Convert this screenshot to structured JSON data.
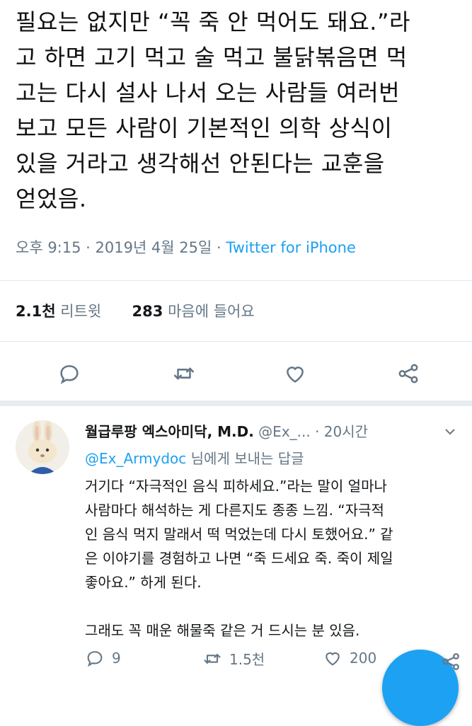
{
  "tweet": {
    "text": "필요는 없지만 “꼭 죽 안 먹어도 돼요.”라\n고 하면 고기 먹고 술 먹고 불닭볶음면 먹\n고는 다시 설사 나서 오는 사람들 여러번\n보고 모든 사람이 기본적인 의학 상식이\n있을 거라고 생각해선 안된다는 교훈을\n얻었음.",
    "timestamp": "오후 9:15 · 2019년 4월 25일 · ",
    "source": "Twitter for iPhone",
    "retweet_count": "2.1천",
    "retweet_label": " 리트윗",
    "like_count": "283",
    "like_label": " 마음에 들어요"
  },
  "reply": {
    "name": "월급루팡 엑스아미닥, M.D.",
    "handle": " @Ex_...",
    "time": " · 20시간",
    "replying_handle": "@Ex_Armydoc",
    "replying_suffix": " 님에게 보내는 답글",
    "text": "거기다 “자극적인 음식 피하세요.”라는 말이 얼마나\n사람마다 해석하는 게 다른지도 종종 느낌. “자극적\n인 음식 먹지 말래서 떡 먹었는데 다시 토했어요.” 같\n은 이야기를 경험하고 나면 “죽 드세요 죽. 죽이 제일\n좋아요.” 하게 된다.\n\n그래도 꼭 매운 해물죽 같은 거 드시는 분 있음.",
    "reply_count": "9",
    "retweet_count": "1.5천",
    "like_count": "200"
  },
  "icons": {
    "reply": "reply-icon",
    "retweet": "retweet-icon",
    "like": "heart-icon",
    "share": "share-icon"
  },
  "colors": {
    "link": "#1da1f2",
    "muted": "#657786",
    "text": "#14171a"
  }
}
